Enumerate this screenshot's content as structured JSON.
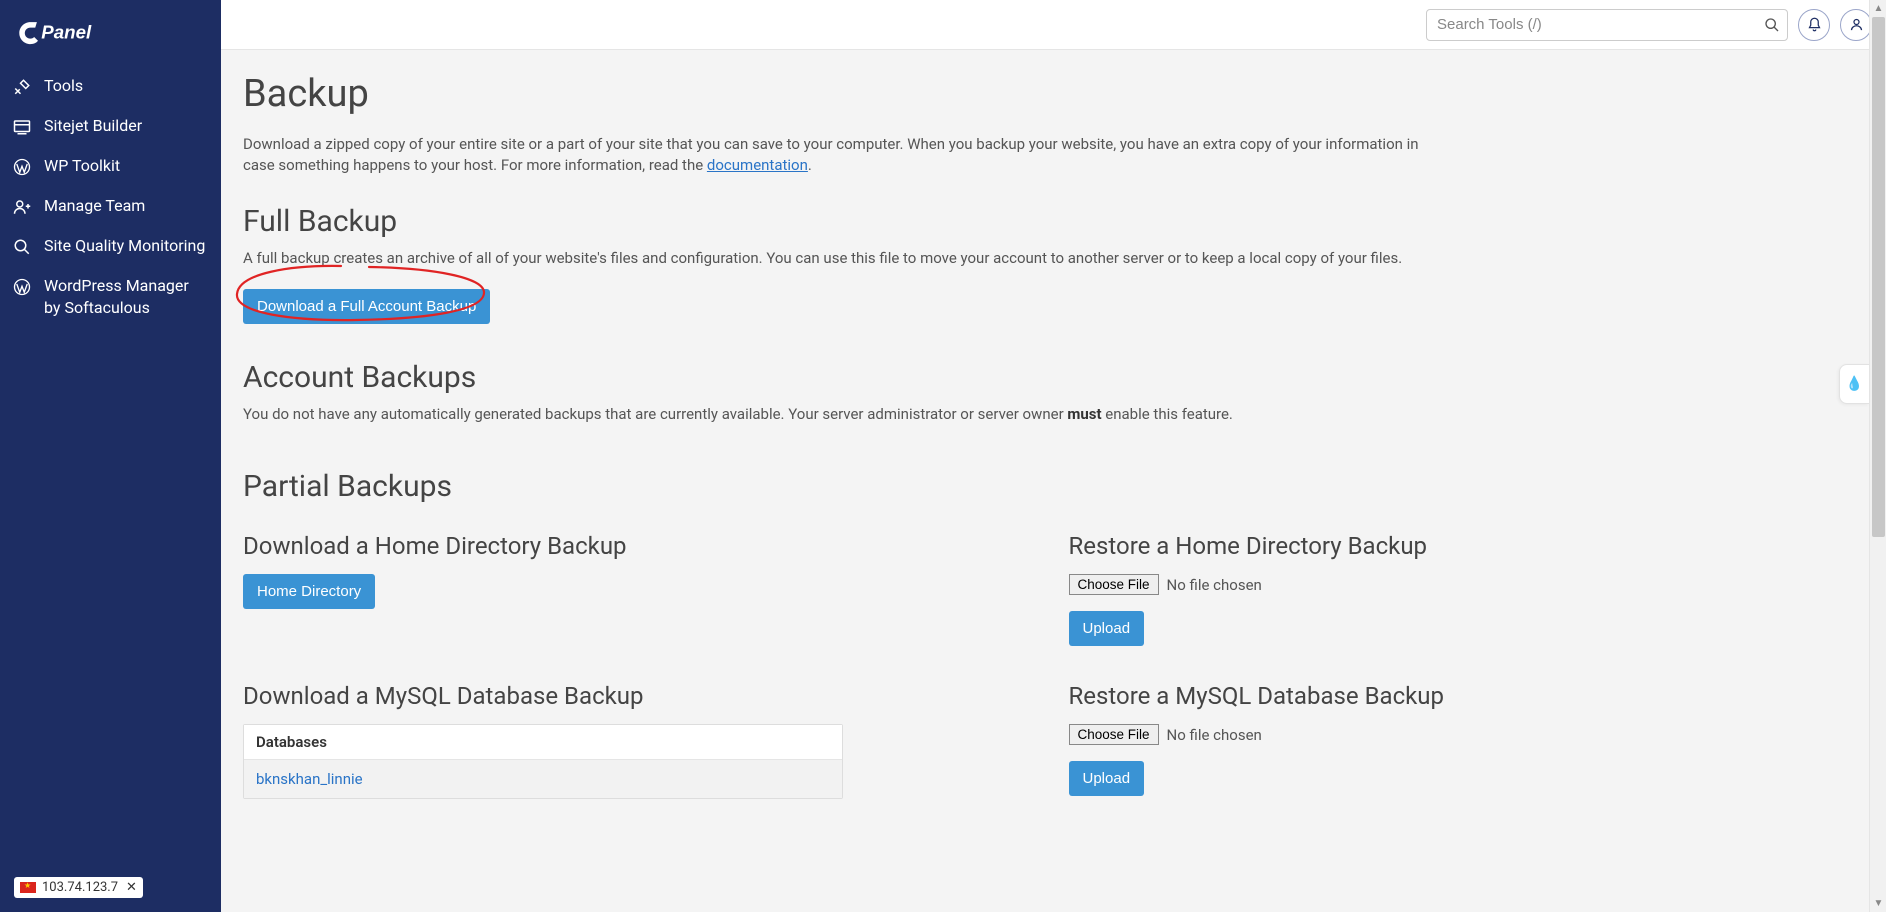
{
  "brand": "cPanel",
  "sidebar": {
    "items": [
      {
        "label": "Tools",
        "icon": "tools-icon"
      },
      {
        "label": "Sitejet Builder",
        "icon": "sitejet-icon"
      },
      {
        "label": "WP Toolkit",
        "icon": "wordpress-icon"
      },
      {
        "label": "Manage Team",
        "icon": "team-icon"
      },
      {
        "label": "Site Quality Monitoring",
        "icon": "monitor-icon"
      },
      {
        "label": "WordPress Manager by Softaculous",
        "icon": "wordpress-icon"
      }
    ]
  },
  "ip_address": "103.74.123.7",
  "search": {
    "placeholder": "Search Tools (/)"
  },
  "page": {
    "title": "Backup",
    "intro_pre": "Download a zipped copy of your entire site or a part of your site that you can save to your computer. When you backup your website, you have an extra copy of your information in case something happens to your host. For more information, read the ",
    "intro_link": "documentation",
    "intro_post": ".",
    "full_backup": {
      "title": "Full Backup",
      "desc": "A full backup creates an archive of all of your website's files and configuration. You can use this file to move your account to another server or to keep a local copy of your files.",
      "button": "Download a Full Account Backup"
    },
    "account_backups": {
      "title": "Account Backups",
      "desc_pre": "You do not have any automatically generated backups that are currently available. Your server administrator or server owner ",
      "desc_bold": "must",
      "desc_post": " enable this feature."
    },
    "partial": {
      "title": "Partial Backups",
      "download_home": {
        "title": "Download a Home Directory Backup",
        "button": "Home Directory"
      },
      "restore_home": {
        "title": "Restore a Home Directory Backup",
        "choose": "Choose File",
        "nofile": "No file chosen",
        "upload": "Upload"
      },
      "download_db": {
        "title": "Download a MySQL Database Backup",
        "header": "Databases",
        "rows": [
          "bknskhan_linnie"
        ]
      },
      "restore_db": {
        "title": "Restore a MySQL Database Backup",
        "choose": "Choose File",
        "nofile": "No file chosen",
        "upload": "Upload"
      }
    }
  }
}
